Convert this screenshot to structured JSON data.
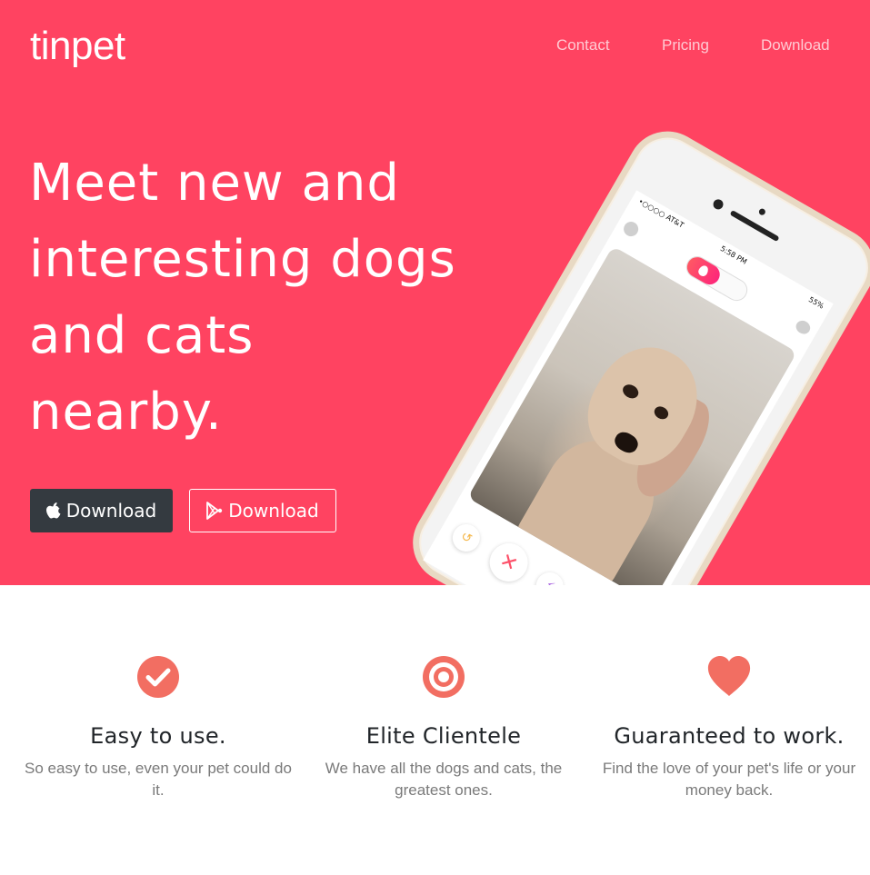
{
  "brand": "tinpet",
  "nav": {
    "contact": "Contact",
    "pricing": "Pricing",
    "download": "Download"
  },
  "hero": {
    "headline": "Meet new and interesting dogs and cats nearby.",
    "apple_button": "Download",
    "play_button": "Download"
  },
  "phone": {
    "carrier": "•○○○○ AT&T",
    "time": "5:58 PM",
    "battery": "55%"
  },
  "features": [
    {
      "icon": "check-circle-icon",
      "title": "Easy to use.",
      "text": "So easy to use, even your pet could do it."
    },
    {
      "icon": "bullseye-icon",
      "title": "Elite Clientele",
      "text": "We have all the dogs and cats, the greatest ones."
    },
    {
      "icon": "heart-icon",
      "title": "Guaranteed to work.",
      "text": "Find the love of your pet's life or your money back."
    }
  ],
  "colors": {
    "hero_bg": "#ff4361",
    "accent": "#f26e62",
    "dark_button": "#343a40"
  }
}
